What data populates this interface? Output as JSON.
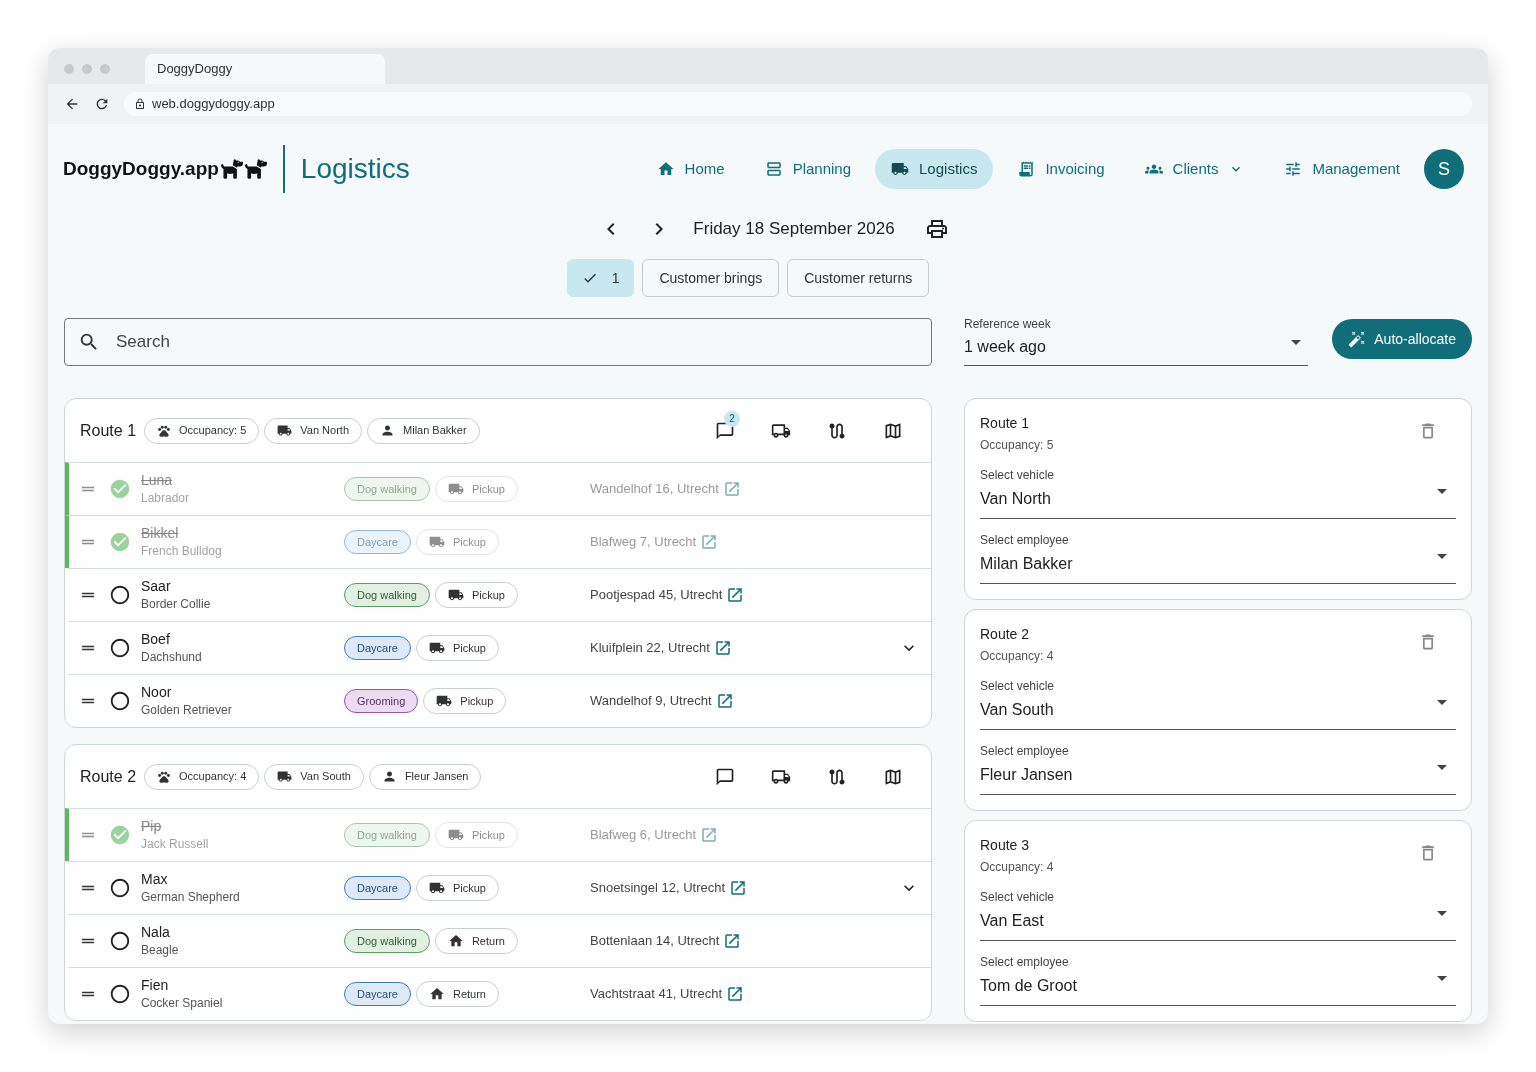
{
  "browser": {
    "tab_title": "DoggyDoggy",
    "url": "web.doggydoggy.app"
  },
  "header": {
    "logo": "DoggyDoggy.app",
    "section_title": "Logistics",
    "avatar": "S",
    "nav": [
      {
        "label": "Home",
        "selected": false,
        "has_menu": false
      },
      {
        "label": "Planning",
        "selected": false,
        "has_menu": false
      },
      {
        "label": "Logistics",
        "selected": true,
        "has_menu": false
      },
      {
        "label": "Invoicing",
        "selected": false,
        "has_menu": false
      },
      {
        "label": "Clients",
        "selected": false,
        "has_menu": true
      },
      {
        "label": "Management",
        "selected": false,
        "has_menu": false
      }
    ]
  },
  "date_bar": {
    "date": "Friday 18 September 2026"
  },
  "filters": [
    {
      "label": "1",
      "kind": "count",
      "selected": true
    },
    {
      "label": "Customer brings",
      "kind": "text",
      "selected": false
    },
    {
      "label": "Customer returns",
      "kind": "text",
      "selected": false
    }
  ],
  "search": {
    "placeholder": "Search"
  },
  "reference_week": {
    "label": "Reference week",
    "value": "1 week ago"
  },
  "auto_allocate": "Auto-allocate",
  "routes": [
    {
      "title": "Route 1",
      "occupancy": "Occupancy: 5",
      "vehicle": "Van North",
      "employee": "Milan Bakker",
      "comments_badge": "2",
      "stops": [
        {
          "name": "Luna",
          "breed": "Labrador",
          "done": true,
          "service": {
            "label": "Dog walking",
            "kind": "walking"
          },
          "transport": {
            "label": "Pickup",
            "kind": "pickup"
          },
          "address": "Wandelhof 16, Utrecht",
          "expandable": false
        },
        {
          "name": "Bikkel",
          "breed": "French Bulldog",
          "done": true,
          "service": {
            "label": "Daycare",
            "kind": "daycare"
          },
          "transport": {
            "label": "Pickup",
            "kind": "pickup"
          },
          "address": "Blafweg 7, Utrecht",
          "expandable": false
        },
        {
          "name": "Saar",
          "breed": "Border Collie",
          "done": false,
          "service": {
            "label": "Dog walking",
            "kind": "walking"
          },
          "transport": {
            "label": "Pickup",
            "kind": "pickup"
          },
          "address": "Pootjespad 45, Utrecht",
          "expandable": false
        },
        {
          "name": "Boef",
          "breed": "Dachshund",
          "done": false,
          "service": {
            "label": "Daycare",
            "kind": "daycare"
          },
          "transport": {
            "label": "Pickup",
            "kind": "pickup"
          },
          "address": "Kluifplein 22, Utrecht",
          "expandable": true
        },
        {
          "name": "Noor",
          "breed": "Golden Retriever",
          "done": false,
          "service": {
            "label": "Grooming",
            "kind": "grooming"
          },
          "transport": {
            "label": "Pickup",
            "kind": "pickup"
          },
          "address": "Wandelhof 9, Utrecht",
          "expandable": false
        }
      ]
    },
    {
      "title": "Route 2",
      "occupancy": "Occupancy: 4",
      "vehicle": "Van South",
      "employee": "Fleur Jansen",
      "stops": [
        {
          "name": "Pip",
          "breed": "Jack Russell",
          "done": true,
          "service": {
            "label": "Dog walking",
            "kind": "walking"
          },
          "transport": {
            "label": "Pickup",
            "kind": "pickup"
          },
          "address": "Blafweg 6, Utrecht",
          "expandable": false
        },
        {
          "name": "Max",
          "breed": "German Shepherd",
          "done": false,
          "service": {
            "label": "Daycare",
            "kind": "daycare"
          },
          "transport": {
            "label": "Pickup",
            "kind": "pickup"
          },
          "address": "Snoetsingel 12, Utrecht",
          "expandable": true
        },
        {
          "name": "Nala",
          "breed": "Beagle",
          "done": false,
          "service": {
            "label": "Dog walking",
            "kind": "walking"
          },
          "transport": {
            "label": "Return",
            "kind": "return"
          },
          "address": "Bottenlaan 14, Utrecht",
          "expandable": false
        },
        {
          "name": "Fien",
          "breed": "Cocker Spaniel",
          "done": false,
          "service": {
            "label": "Daycare",
            "kind": "daycare"
          },
          "transport": {
            "label": "Return",
            "kind": "return"
          },
          "address": "Vachtstraat 41, Utrecht",
          "expandable": false
        }
      ]
    }
  ],
  "side_routes": [
    {
      "title": "Route 1",
      "occupancy": "Occupancy: 5",
      "vehicle_label": "Select vehicle",
      "vehicle": "Van North",
      "employee_label": "Select employee",
      "employee": "Milan Bakker"
    },
    {
      "title": "Route 2",
      "occupancy": "Occupancy: 4",
      "vehicle_label": "Select vehicle",
      "vehicle": "Van South",
      "employee_label": "Select employee",
      "employee": "Fleur Jansen"
    },
    {
      "title": "Route 3",
      "occupancy": "Occupancy: 4",
      "vehicle_label": "Select vehicle",
      "vehicle": "Van East",
      "employee_label": "Select employee",
      "employee": "Tom de Groot"
    }
  ]
}
